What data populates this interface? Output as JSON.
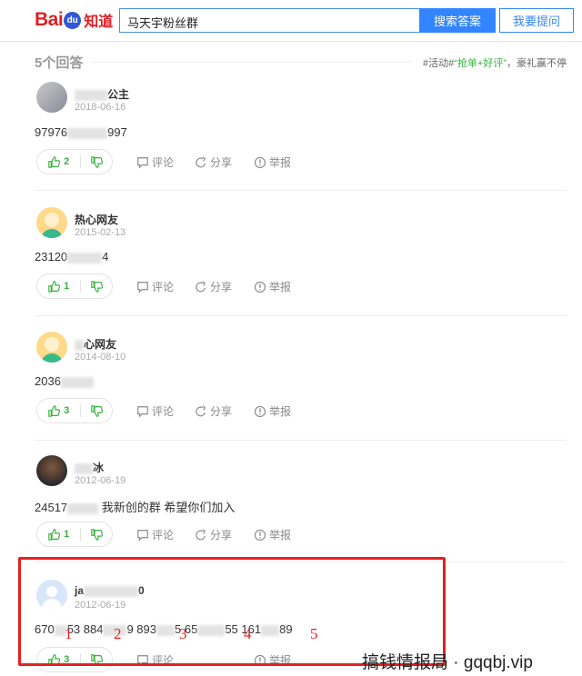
{
  "header": {
    "logo_bai": "Bai",
    "logo_du": "du",
    "logo_zhidao": "知道",
    "search_value": "马天宇粉丝群",
    "search_button": "搜索答案",
    "ask_button": "我要提问"
  },
  "answers_header": {
    "count_label": "5个回答",
    "promo_tag": "#活动#",
    "promo_green": "“抢单+好评”",
    "promo_rest": "，豪礼赢不停"
  },
  "actions": {
    "comment": "评论",
    "share": "分享",
    "report": "举报"
  },
  "answers": [
    {
      "name_start": "",
      "name_end": "公主",
      "date": "2018-06-16",
      "content_start": "97976",
      "content_end": "997",
      "likes": "2"
    },
    {
      "name_start": "热心网友",
      "name_end": "",
      "date": "2015-02-13",
      "content_start": "23120",
      "content_end": "4",
      "likes": "1"
    },
    {
      "name_start": "",
      "name_end": "心网友",
      "date": "2014-08-10",
      "content_start": "2036",
      "content_end": "",
      "likes": "3"
    },
    {
      "name_start": "",
      "name_end": "冰",
      "date": "2012-06-19",
      "content_start": "24517",
      "content_end": " 我新创的群 希望你们加入",
      "likes": "1"
    },
    {
      "name_start": "ja",
      "name_end": "0",
      "date": "2012-06-19",
      "content_parts": [
        "670",
        "53 884",
        "9 893",
        "5 65",
        "55 161",
        "89"
      ],
      "likes": "3"
    }
  ],
  "markers": [
    "1",
    "2",
    "3",
    "4",
    "5"
  ],
  "watermark": "搞钱情报局 · gqqbj.vip",
  "colors": {
    "accent_blue": "#3385ff",
    "brand_red": "#de1f26",
    "vote_green": "#38b03f",
    "highlight_red": "#e52020"
  }
}
